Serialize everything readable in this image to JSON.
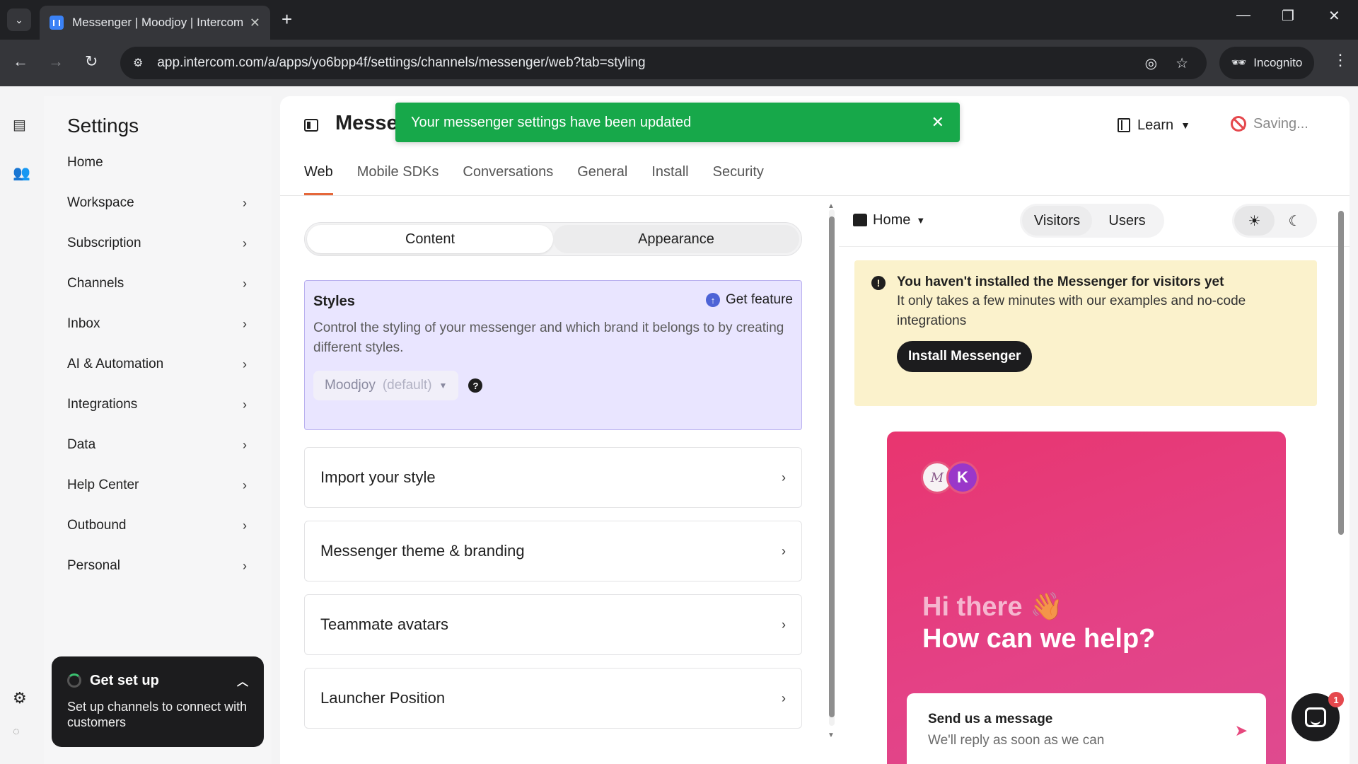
{
  "browser": {
    "tab_title": "Messenger | Moodjoy | Intercom",
    "url": "app.intercom.com/a/apps/yo6bpp4f/settings/channels/messenger/web?tab=styling",
    "incognito_label": "Incognito"
  },
  "sidebar": {
    "title": "Settings",
    "items": [
      {
        "label": "Home"
      },
      {
        "label": "Workspace"
      },
      {
        "label": "Subscription"
      },
      {
        "label": "Channels"
      },
      {
        "label": "Inbox"
      },
      {
        "label": "AI & Automation"
      },
      {
        "label": "Integrations"
      },
      {
        "label": "Data"
      },
      {
        "label": "Help Center"
      },
      {
        "label": "Outbound"
      },
      {
        "label": "Personal"
      }
    ],
    "setup": {
      "title": "Get set up",
      "description": "Set up channels to connect with customers"
    }
  },
  "header": {
    "title": "Messe",
    "toast": "Your messenger settings have been updated",
    "learn_label": "Learn",
    "saving_label": "Saving..."
  },
  "tabs": [
    "Web",
    "Mobile SDKs",
    "Conversations",
    "General",
    "Install",
    "Security"
  ],
  "segments": {
    "content": "Content",
    "appearance": "Appearance"
  },
  "styles": {
    "title": "Styles",
    "get_feature": "Get feature",
    "description": "Control the styling of your messenger and which brand it belongs to by creating different styles.",
    "selected_style": "Moodjoy",
    "selected_suffix": "(default)"
  },
  "accordions": [
    "Import your style",
    "Messenger theme & branding",
    "Teammate avatars",
    "Launcher Position"
  ],
  "preview": {
    "home_label": "Home",
    "visitors_label": "Visitors",
    "users_label": "Users",
    "notice_title": "You haven't installed the Messenger for visitors yet",
    "notice_desc": "It only takes a few minutes with our examples and no-code integrations",
    "install_button": "Install Messenger",
    "avatar_letter": "K",
    "greeting_line1": "Hi there 👋",
    "greeting_line2": "How can we help?",
    "send_title": "Send us a message",
    "send_subtitle": "We'll reply as soon as we can",
    "launcher_badge": "1"
  },
  "colors": {
    "accent_tab": "#e5673a",
    "toast_green": "#17a84a",
    "messenger_pink": "#e44185",
    "styles_bg": "#e9e5ff"
  }
}
